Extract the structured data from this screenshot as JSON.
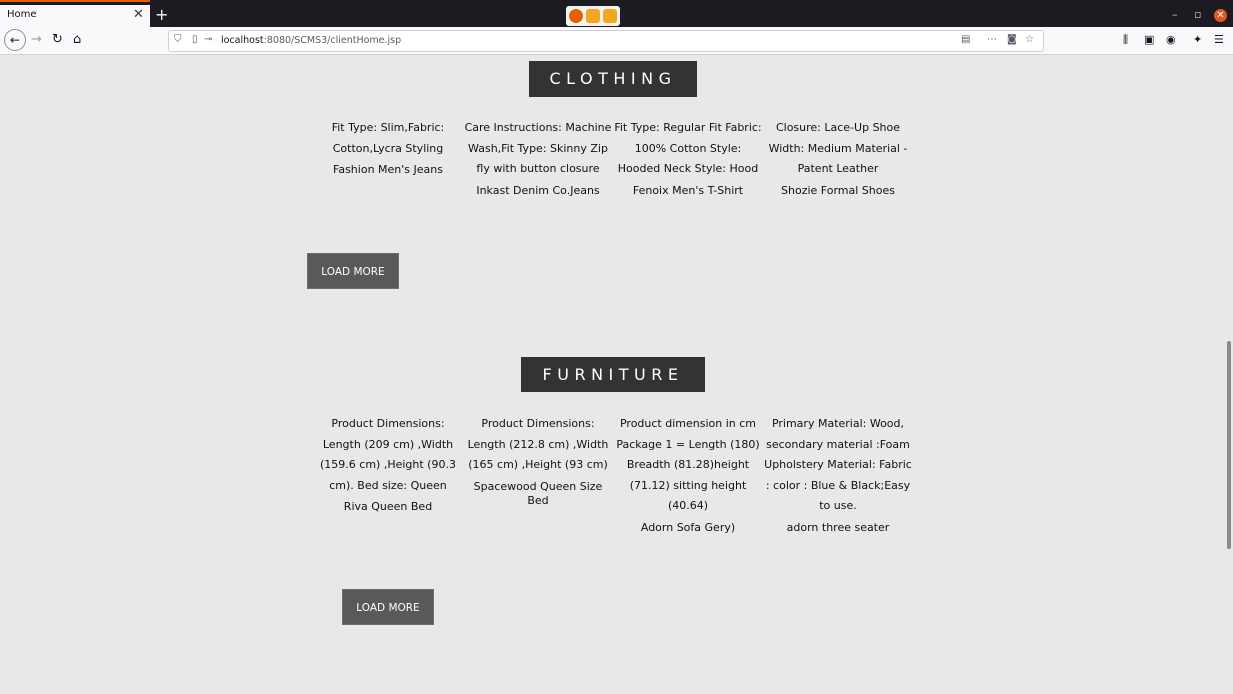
{
  "browser": {
    "tab_title": "Home",
    "url_host": "localhost",
    "url_rest": ":8080/SCMS3/clientHome.jsp"
  },
  "clothing": {
    "heading": "CLOTHING",
    "items": [
      {
        "description": "Fit Type: Slim,Fabric: Cotton,Lycra Styling",
        "name": "Fashion Men's Jeans"
      },
      {
        "description": "Care Instructions: Machine Wash,Fit Type: Skinny Zip fly with button closure",
        "name": "Inkast Denim Co.Jeans"
      },
      {
        "description": "Fit Type: Regular Fit Fabric: 100% Cotton Style: Hooded Neck Style: Hood",
        "name": "Fenoix Men's T-Shirt"
      },
      {
        "description": "Closure: Lace-Up Shoe Width: Medium Material - Patent Leather",
        "name": "Shozie Formal Shoes"
      }
    ],
    "load_more": "LOAD MORE"
  },
  "furniture": {
    "heading": "FURNITURE",
    "items": [
      {
        "description": "Product Dimensions: Length (209 cm) ,Width (159.6 cm) ,Height (90.3 cm). Bed size: Queen",
        "name": "Riva Queen Bed"
      },
      {
        "description": "Product Dimensions: Length (212.8 cm) ,Width (165 cm) ,Height (93 cm)",
        "name": "Spacewood Queen Size Bed"
      },
      {
        "description": "Product dimension in cm Package 1 = Length (180) Breadth (81.28)height (71.12) sitting height (40.64)",
        "name": "Adorn Sofa Gery)"
      },
      {
        "description": "Primary Material: Wood, secondary material :Foam Upholstery Material: Fabric : color : Blue & Black;Easy to use.",
        "name": "adorn three seater"
      }
    ],
    "load_more": "LOAD MORE"
  }
}
